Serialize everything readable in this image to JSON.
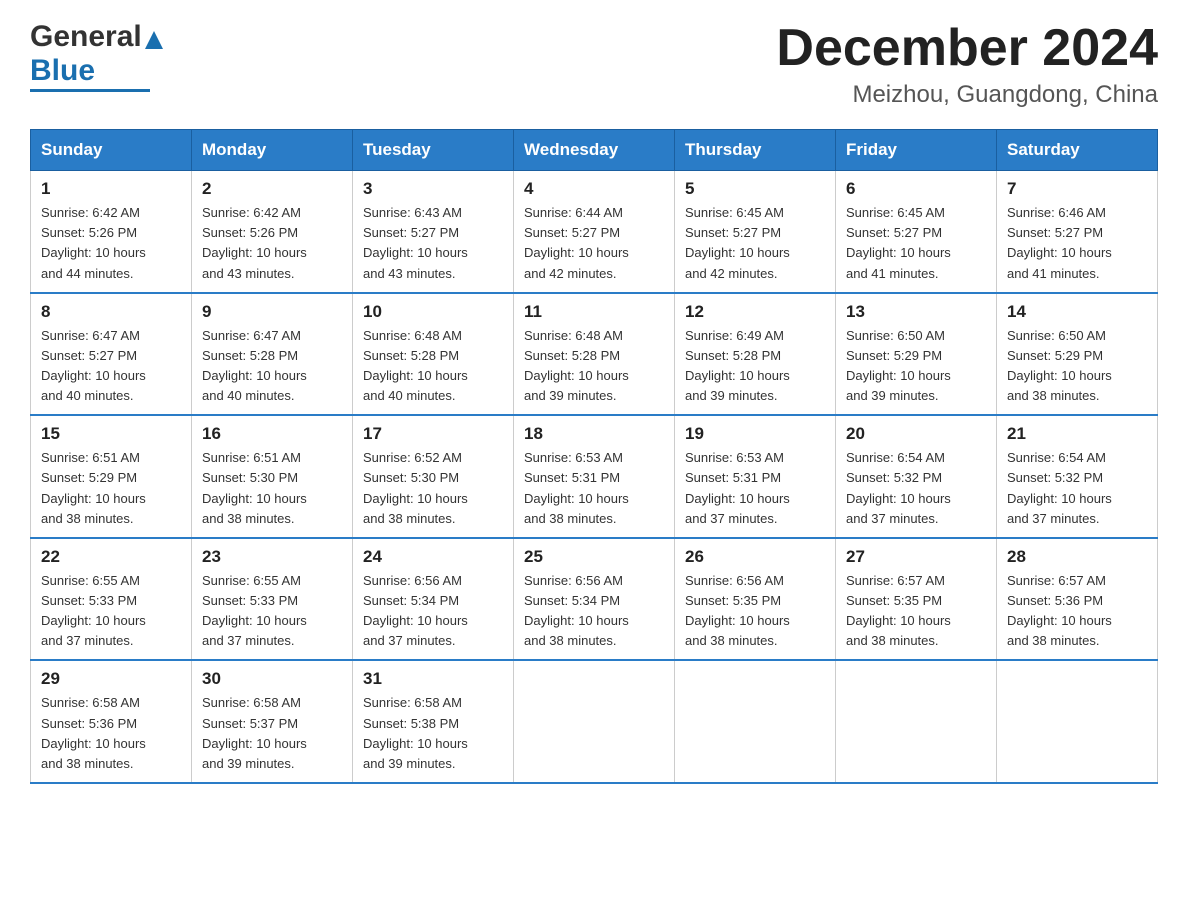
{
  "logo": {
    "text_general": "General",
    "text_blue": "Blue",
    "triangle_symbol": "▲"
  },
  "header": {
    "month_year": "December 2024",
    "location": "Meizhou, Guangdong, China"
  },
  "weekdays": [
    "Sunday",
    "Monday",
    "Tuesday",
    "Wednesday",
    "Thursday",
    "Friday",
    "Saturday"
  ],
  "weeks": [
    [
      {
        "day": "1",
        "sunrise": "6:42 AM",
        "sunset": "5:26 PM",
        "daylight": "10 hours and 44 minutes."
      },
      {
        "day": "2",
        "sunrise": "6:42 AM",
        "sunset": "5:26 PM",
        "daylight": "10 hours and 43 minutes."
      },
      {
        "day": "3",
        "sunrise": "6:43 AM",
        "sunset": "5:27 PM",
        "daylight": "10 hours and 43 minutes."
      },
      {
        "day": "4",
        "sunrise": "6:44 AM",
        "sunset": "5:27 PM",
        "daylight": "10 hours and 42 minutes."
      },
      {
        "day": "5",
        "sunrise": "6:45 AM",
        "sunset": "5:27 PM",
        "daylight": "10 hours and 42 minutes."
      },
      {
        "day": "6",
        "sunrise": "6:45 AM",
        "sunset": "5:27 PM",
        "daylight": "10 hours and 41 minutes."
      },
      {
        "day": "7",
        "sunrise": "6:46 AM",
        "sunset": "5:27 PM",
        "daylight": "10 hours and 41 minutes."
      }
    ],
    [
      {
        "day": "8",
        "sunrise": "6:47 AM",
        "sunset": "5:27 PM",
        "daylight": "10 hours and 40 minutes."
      },
      {
        "day": "9",
        "sunrise": "6:47 AM",
        "sunset": "5:28 PM",
        "daylight": "10 hours and 40 minutes."
      },
      {
        "day": "10",
        "sunrise": "6:48 AM",
        "sunset": "5:28 PM",
        "daylight": "10 hours and 40 minutes."
      },
      {
        "day": "11",
        "sunrise": "6:48 AM",
        "sunset": "5:28 PM",
        "daylight": "10 hours and 39 minutes."
      },
      {
        "day": "12",
        "sunrise": "6:49 AM",
        "sunset": "5:28 PM",
        "daylight": "10 hours and 39 minutes."
      },
      {
        "day": "13",
        "sunrise": "6:50 AM",
        "sunset": "5:29 PM",
        "daylight": "10 hours and 39 minutes."
      },
      {
        "day": "14",
        "sunrise": "6:50 AM",
        "sunset": "5:29 PM",
        "daylight": "10 hours and 38 minutes."
      }
    ],
    [
      {
        "day": "15",
        "sunrise": "6:51 AM",
        "sunset": "5:29 PM",
        "daylight": "10 hours and 38 minutes."
      },
      {
        "day": "16",
        "sunrise": "6:51 AM",
        "sunset": "5:30 PM",
        "daylight": "10 hours and 38 minutes."
      },
      {
        "day": "17",
        "sunrise": "6:52 AM",
        "sunset": "5:30 PM",
        "daylight": "10 hours and 38 minutes."
      },
      {
        "day": "18",
        "sunrise": "6:53 AM",
        "sunset": "5:31 PM",
        "daylight": "10 hours and 38 minutes."
      },
      {
        "day": "19",
        "sunrise": "6:53 AM",
        "sunset": "5:31 PM",
        "daylight": "10 hours and 37 minutes."
      },
      {
        "day": "20",
        "sunrise": "6:54 AM",
        "sunset": "5:32 PM",
        "daylight": "10 hours and 37 minutes."
      },
      {
        "day": "21",
        "sunrise": "6:54 AM",
        "sunset": "5:32 PM",
        "daylight": "10 hours and 37 minutes."
      }
    ],
    [
      {
        "day": "22",
        "sunrise": "6:55 AM",
        "sunset": "5:33 PM",
        "daylight": "10 hours and 37 minutes."
      },
      {
        "day": "23",
        "sunrise": "6:55 AM",
        "sunset": "5:33 PM",
        "daylight": "10 hours and 37 minutes."
      },
      {
        "day": "24",
        "sunrise": "6:56 AM",
        "sunset": "5:34 PM",
        "daylight": "10 hours and 37 minutes."
      },
      {
        "day": "25",
        "sunrise": "6:56 AM",
        "sunset": "5:34 PM",
        "daylight": "10 hours and 38 minutes."
      },
      {
        "day": "26",
        "sunrise": "6:56 AM",
        "sunset": "5:35 PM",
        "daylight": "10 hours and 38 minutes."
      },
      {
        "day": "27",
        "sunrise": "6:57 AM",
        "sunset": "5:35 PM",
        "daylight": "10 hours and 38 minutes."
      },
      {
        "day": "28",
        "sunrise": "6:57 AM",
        "sunset": "5:36 PM",
        "daylight": "10 hours and 38 minutes."
      }
    ],
    [
      {
        "day": "29",
        "sunrise": "6:58 AM",
        "sunset": "5:36 PM",
        "daylight": "10 hours and 38 minutes."
      },
      {
        "day": "30",
        "sunrise": "6:58 AM",
        "sunset": "5:37 PM",
        "daylight": "10 hours and 39 minutes."
      },
      {
        "day": "31",
        "sunrise": "6:58 AM",
        "sunset": "5:38 PM",
        "daylight": "10 hours and 39 minutes."
      },
      null,
      null,
      null,
      null
    ]
  ],
  "labels": {
    "sunrise": "Sunrise:",
    "sunset": "Sunset:",
    "daylight": "Daylight:"
  }
}
